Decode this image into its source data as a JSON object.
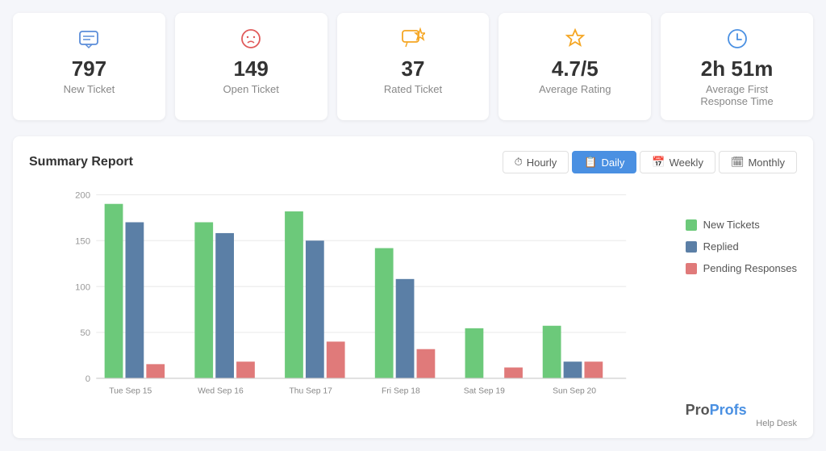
{
  "stats": [
    {
      "id": "new-ticket",
      "number": "797",
      "label": "New Ticket",
      "icon": "chat-icon",
      "icon_color": "#5b8dd9",
      "icon_type": "chat"
    },
    {
      "id": "open-ticket",
      "number": "149",
      "label": "Open Ticket",
      "icon": "sad-icon",
      "icon_color": "#e05a5a",
      "icon_type": "sad"
    },
    {
      "id": "rated-ticket",
      "number": "37",
      "label": "Rated Ticket",
      "icon": "chat-star-icon",
      "icon_color": "#f5a623",
      "icon_type": "chat-star"
    },
    {
      "id": "avg-rating",
      "number": "4.7/5",
      "label": "Average Rating",
      "icon": "star-icon",
      "icon_color": "#f5a623",
      "icon_type": "star"
    },
    {
      "id": "avg-response",
      "number": "2h 51m",
      "label": "Average First\nResponse Time",
      "icon": "clock-icon",
      "icon_color": "#4a90e2",
      "icon_type": "clock"
    }
  ],
  "report": {
    "title": "Summary Report",
    "tabs": [
      {
        "id": "hourly",
        "label": "Hourly",
        "active": false
      },
      {
        "id": "daily",
        "label": "Daily",
        "active": true
      },
      {
        "id": "weekly",
        "label": "Weekly",
        "active": false
      },
      {
        "id": "monthly",
        "label": "Monthly",
        "active": false
      }
    ],
    "legend": [
      {
        "label": "New Tickets",
        "color": "#6cc97a"
      },
      {
        "label": "Replied",
        "color": "#5b7fa6"
      },
      {
        "label": "Pending Responses",
        "color": "#e07a7a"
      }
    ],
    "days": [
      "Tue Sep 15",
      "Wed Sep 16",
      "Thu Sep 17",
      "Fri Sep 18",
      "Sat Sep 19",
      "Sun Sep 20"
    ],
    "new_tickets": [
      190,
      170,
      182,
      142,
      54,
      58
    ],
    "replied": [
      170,
      158,
      150,
      108,
      0,
      18
    ],
    "pending": [
      15,
      18,
      40,
      32,
      12,
      18
    ],
    "y_labels": [
      0,
      50,
      100,
      150,
      200
    ]
  },
  "logo": {
    "pro": "Pro",
    "profs": "Profs",
    "sub": "Help Desk"
  }
}
